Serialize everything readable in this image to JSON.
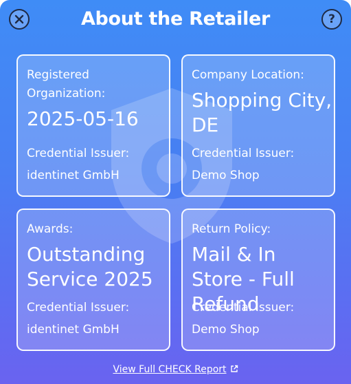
{
  "header": {
    "title": "About the Retailer",
    "close_icon": "close-icon",
    "help_icon": "help-icon",
    "help_glyph": "?"
  },
  "cards": [
    {
      "label": "Registered Organization:",
      "value": "2025-05-16",
      "issuer_label": "Credential Issuer:",
      "issuer": "identinet GmbH"
    },
    {
      "label": "Company Location:",
      "value": "Shopping City, DE",
      "issuer_label": "Credential Issuer:",
      "issuer": "Demo Shop"
    },
    {
      "label": "Awards:",
      "value": "Outstanding Service 2025",
      "issuer_label": "Credential Issuer:",
      "issuer": "identinet GmbH"
    },
    {
      "label": "Return Policy:",
      "value": "Mail & In Store - Full Refund",
      "issuer_label": "Credential Issuer:",
      "issuer": "Demo Shop"
    }
  ],
  "footer": {
    "link_label": "View Full CHECK Report",
    "link_icon": "external-link-icon"
  },
  "colors": {
    "gradient_top": "#3f8cf6",
    "gradient_bottom": "#6a63f0",
    "icon_dark": "#1e2a44"
  }
}
